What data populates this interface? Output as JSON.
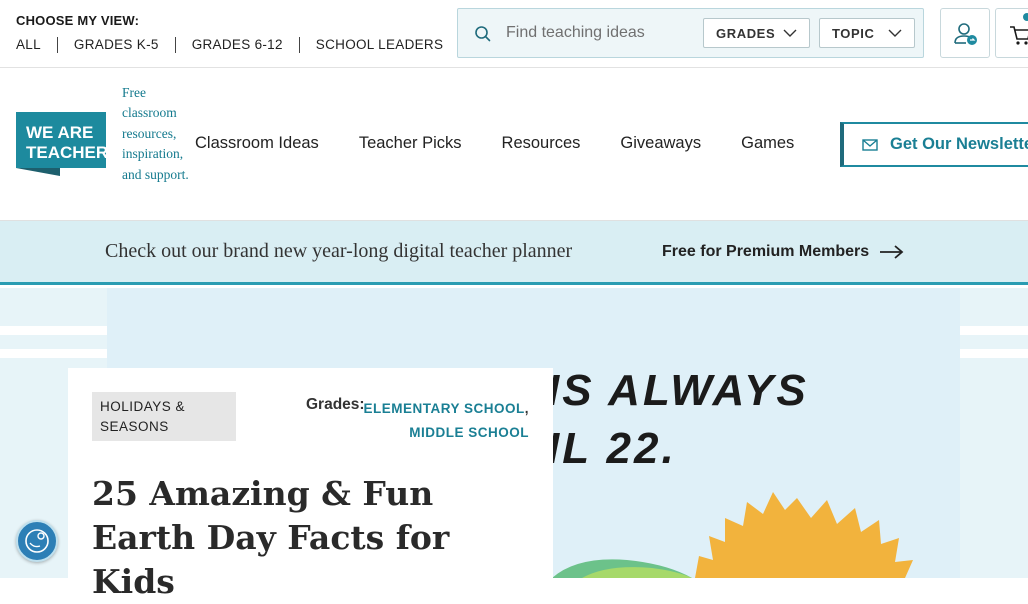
{
  "view_selector": {
    "label": "CHOOSE MY VIEW:",
    "options": [
      "ALL",
      "GRADES K-5",
      "GRADES 6-12",
      "SCHOOL LEADERS"
    ]
  },
  "search": {
    "placeholder": "Find teaching ideas",
    "grades_label": "GRADES",
    "topic_label": "TOPIC"
  },
  "brand": {
    "logo_line1": "WE ARE",
    "logo_line2": "TEACHERS",
    "tagline": "Free classroom resources, inspiration, and support.",
    "color": "#1d8a9e"
  },
  "nav": {
    "items": [
      "Classroom Ideas",
      "Teacher Picks",
      "Resources",
      "Giveaways",
      "Games"
    ],
    "newsletter_label": "Get Our Newsletter"
  },
  "promo": {
    "text": "Check out our brand new year-long digital teacher planner",
    "link_label": "Free for Premium Members"
  },
  "hero": {
    "image_text_line1": "IS ALWAYS",
    "image_text_line2": "IL 22."
  },
  "article": {
    "category": "HOLIDAYS & SEASONS",
    "grades_label": "Grades:",
    "grade_1": "ELEMENTARY SCHOOL",
    "grade_2": "MIDDLE SCHOOL",
    "title": "25 Amazing & Fun Earth Day Facts for Kids"
  },
  "icons": {
    "search": "search-icon",
    "account": "account-icon",
    "cart": "cart-icon",
    "mail": "mail-icon",
    "arrow": "arrow-right-icon",
    "accessibility": "accessibility-icon"
  }
}
